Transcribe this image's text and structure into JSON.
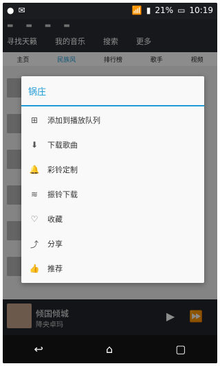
{
  "status_bar": {
    "battery_percent": "21%",
    "time": "10:19"
  },
  "app": {
    "top_nav": [
      "寻找天籁",
      "我的音乐",
      "搜索",
      "更多"
    ],
    "sub_tabs": [
      "主页",
      "民族风",
      "排行榜",
      "歌手",
      "视频"
    ],
    "active_sub_tab": "民族风"
  },
  "dialog": {
    "title": "锅庄",
    "items": [
      {
        "label": "添加到播放队列",
        "icon": "playlist-add-icon"
      },
      {
        "label": "下载歌曲",
        "icon": "download-icon"
      },
      {
        "label": "彩铃定制",
        "icon": "ringtone-icon"
      },
      {
        "label": "振铃下载",
        "icon": "vibration-download-icon"
      },
      {
        "label": "收藏",
        "icon": "heart-icon"
      },
      {
        "label": "分享",
        "icon": "share-icon"
      },
      {
        "label": "推荐",
        "icon": "thumbs-up-icon"
      }
    ]
  },
  "player": {
    "track": "倾国倾城",
    "artist": "降央卓玛"
  },
  "colors": {
    "accent": "#1e9bd7",
    "dialog_bg": "#f9f9f9",
    "scrim": "rgba(0,0,0,0.45)",
    "player_bg": "#22252b"
  }
}
